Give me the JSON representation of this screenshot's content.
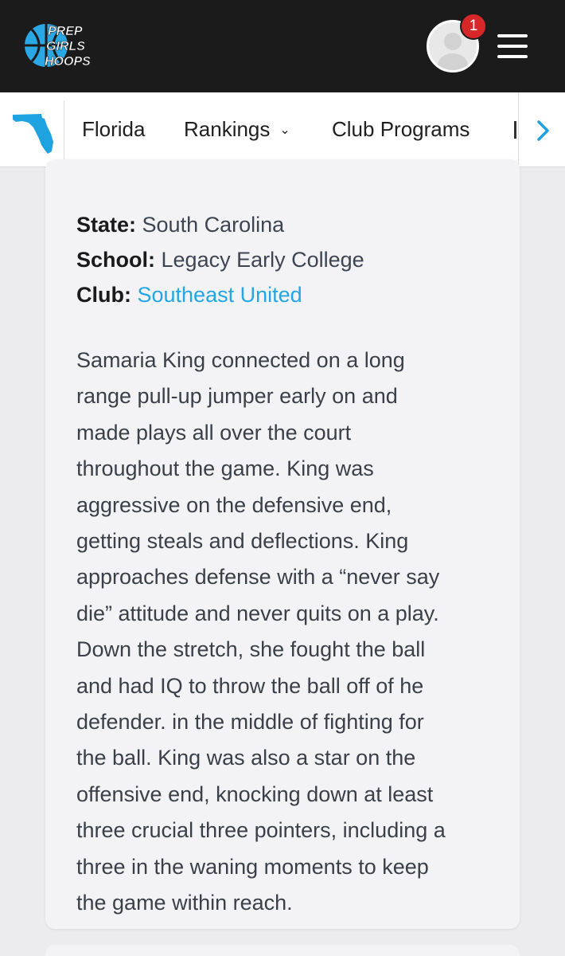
{
  "header": {
    "logo_lines": [
      "PREP",
      "GIRLS",
      "HOOPS"
    ],
    "notification_count": "1"
  },
  "nav": {
    "items": [
      {
        "label": "Florida"
      },
      {
        "label": "Rankings"
      },
      {
        "label": "Club Programs"
      }
    ]
  },
  "profile": {
    "state_label": "State:",
    "state_value": "South Carolina",
    "school_label": "School:",
    "school_value": "Legacy Early College",
    "club_label": "Club:",
    "club_value": "Southeast United"
  },
  "report": {
    "lines": [
      "Samaria King connected on a long",
      "range pull-up jumper early on and",
      "made plays all over the court",
      "throughout the game. King was",
      "aggressive on the defensive end,",
      "getting steals and deflections. King",
      "approaches defense with a “never say",
      "die” attitude and never quits on a play.",
      "Down the stretch, she fought the ball",
      "and had IQ to throw the ball off of he",
      "defender. in the middle of fighting for",
      "the ball.  King was also a star on the",
      "offensive end, knocking down at least",
      "three crucial three pointers, including a",
      "three in the waning moments to keep",
      "the game within reach."
    ]
  },
  "colors": {
    "topbar": "#1b1b1b",
    "logo_ball": "#2aa8e6",
    "badge": "#d62828",
    "link": "#23a6e3",
    "state_icon": "#1fa3e0"
  }
}
